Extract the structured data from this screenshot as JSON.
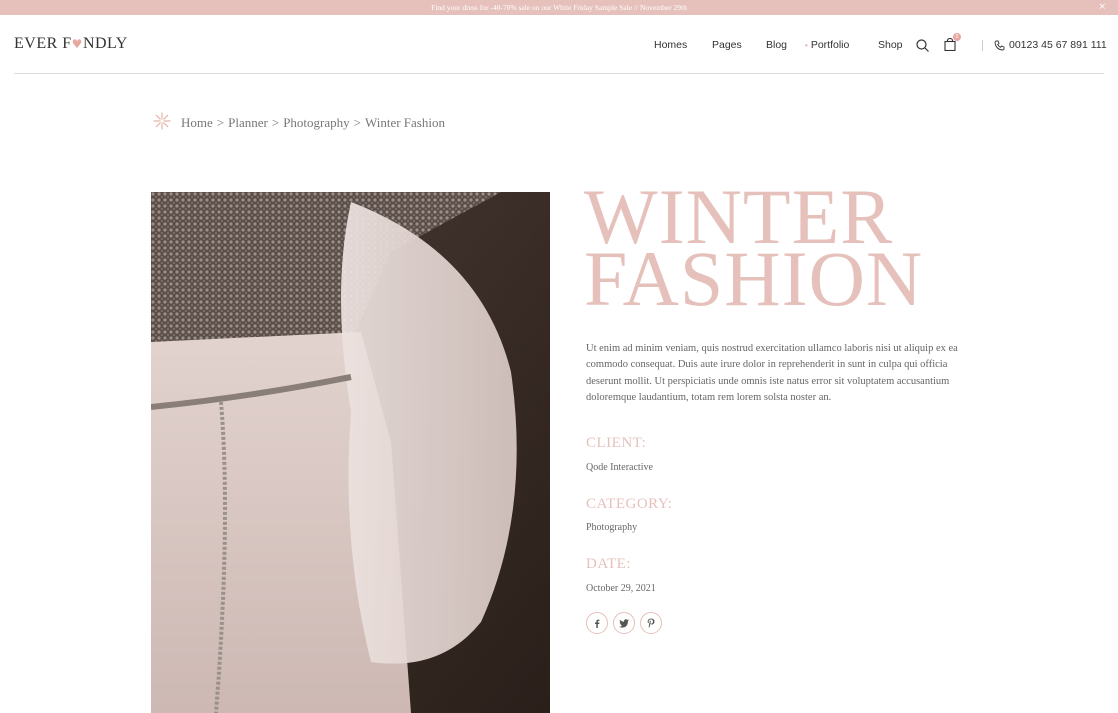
{
  "promo": {
    "text": "Find your dress for -40-70% sale on our White Friday Sample Sale // November 29th",
    "close": "×"
  },
  "logo": {
    "left": "EVER F",
    "heart": "♥",
    "right": "NDLY"
  },
  "nav": {
    "items": [
      {
        "label": "Homes"
      },
      {
        "label": "Pages"
      },
      {
        "label": "Blog"
      },
      {
        "label": "Portfolio",
        "dot": "•"
      },
      {
        "label": "Shop"
      }
    ],
    "search_icon": "search-icon",
    "cart_icon": "shopping-bag-icon",
    "cart_count": "0",
    "phone": "00123 45 67 891 111"
  },
  "breadcrumb": {
    "items": [
      "Home",
      "Planner",
      "Photography",
      "Winter Fashion"
    ],
    "sep": ">"
  },
  "project": {
    "title_line1": "WINTER",
    "title_line2": "FASHION",
    "description": "Ut enim ad minim veniam, quis nostrud exercitation ullamco laboris nisi ut aliquip ex ea commodo consequat. Duis aute irure dolor in reprehenderit in sunt in culpa qui officia deserunt mollit. Ut perspiciatis unde omnis iste natus error sit voluptatem accusantium doloremque laudantium, totam rem lorem solsta noster an.",
    "client_label": "CLIENT:",
    "client_value": "Qode Interactive",
    "category_label": "CATEGORY:",
    "category_value": "Photography",
    "date_label": "DATE:",
    "date_value": "October 29, 2021"
  },
  "social": [
    "facebook-icon",
    "twitter-icon",
    "pinterest-icon"
  ],
  "colors": {
    "accent": "#e6c1bb",
    "text": "#666666",
    "dark": "#333333"
  }
}
